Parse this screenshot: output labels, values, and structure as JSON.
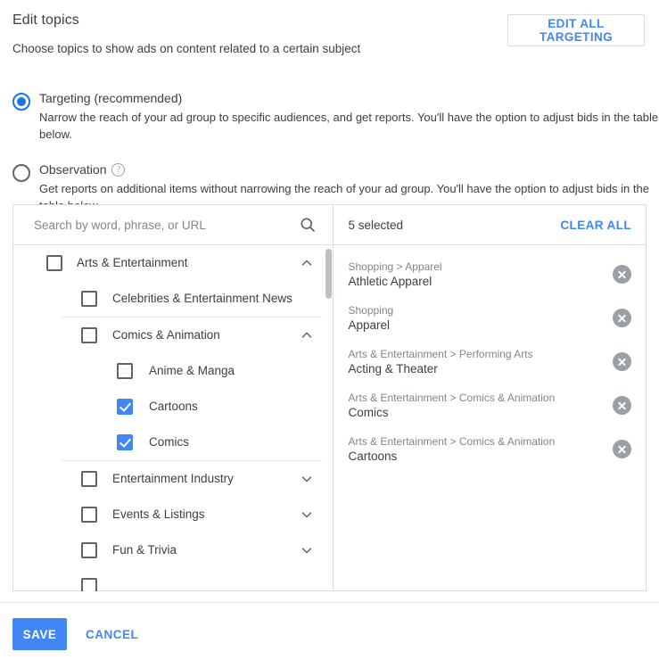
{
  "header": {
    "title": "Edit topics",
    "subtitle": "Choose topics to show ads on content related to a certain subject",
    "edit_all_label": "EDIT ALL TARGETING"
  },
  "mode_options": [
    {
      "label": "Targeting (recommended)",
      "description": "Narrow the reach of your ad group to specific audiences, and get reports. You'll have the option to adjust bids in the table below.",
      "selected": true,
      "has_help_icon": false
    },
    {
      "label": "Observation",
      "description": "Get reports on additional items without narrowing the reach of your ad group. You'll have the option to adjust bids in the table below.",
      "selected": false,
      "has_help_icon": true
    }
  ],
  "search": {
    "placeholder": "Search by word, phrase, or URL",
    "value": "",
    "icon": "search-icon"
  },
  "tree": [
    {
      "label": "Arts & Entertainment",
      "level": 0,
      "checked": false,
      "chevron": "chevron-up-icon",
      "divider_after": false
    },
    {
      "label": "Celebrities & Entertainment News",
      "level": 1,
      "checked": false,
      "chevron": "",
      "divider_after": true
    },
    {
      "label": "Comics & Animation",
      "level": 1,
      "checked": false,
      "chevron": "chevron-up-icon",
      "divider_after": false
    },
    {
      "label": "Anime & Manga",
      "level": 2,
      "checked": false,
      "chevron": "",
      "divider_after": false
    },
    {
      "label": "Cartoons",
      "level": 2,
      "checked": true,
      "chevron": "",
      "divider_after": false
    },
    {
      "label": "Comics",
      "level": 2,
      "checked": true,
      "chevron": "",
      "divider_after": true
    },
    {
      "label": "Entertainment Industry",
      "level": 1,
      "checked": false,
      "chevron": "chevron-down-icon",
      "divider_after": false
    },
    {
      "label": "Events & Listings",
      "level": 1,
      "checked": false,
      "chevron": "chevron-down-icon",
      "divider_after": false
    },
    {
      "label": "Fun & Trivia",
      "level": 1,
      "checked": false,
      "chevron": "chevron-down-icon",
      "divider_after": false
    },
    {
      "label": "",
      "level": 1,
      "checked": false,
      "chevron": "",
      "divider_after": false
    }
  ],
  "selected_panel": {
    "count_label": "5 selected",
    "clear_all_label": "CLEAR ALL",
    "items": [
      {
        "path": "Shopping > Apparel",
        "name": "Athletic Apparel"
      },
      {
        "path": "Shopping",
        "name": "Apparel"
      },
      {
        "path": "Arts & Entertainment > Performing Arts",
        "name": "Acting & Theater"
      },
      {
        "path": "Arts & Entertainment > Comics & Animation",
        "name": "Comics"
      },
      {
        "path": "Arts & Entertainment > Comics & Animation",
        "name": "Cartoons"
      }
    ]
  },
  "footer": {
    "save_label": "SAVE",
    "cancel_label": "CANCEL"
  },
  "colors": {
    "accent_blue": "#4285f4",
    "radio_blue": "#1a73e8",
    "link_blue": "#4285f4",
    "border_gray": "#dadce0",
    "text_primary": "#3c4043",
    "text_secondary": "#80868b",
    "remove_gray": "#9aa0a6"
  }
}
